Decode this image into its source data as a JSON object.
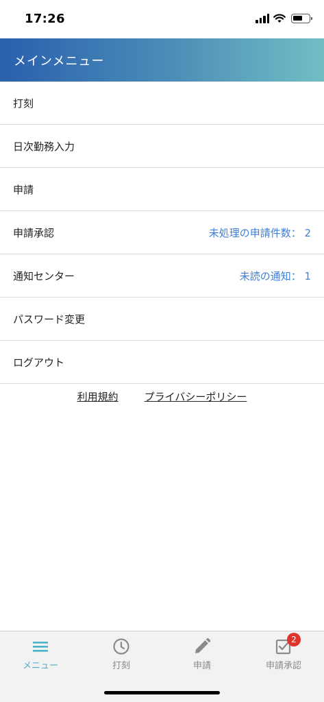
{
  "status_bar": {
    "time": "17:26"
  },
  "header": {
    "title": "メインメニュー"
  },
  "menu": {
    "items": [
      {
        "label": "打刻",
        "value": ""
      },
      {
        "label": "日次勤務入力",
        "value": ""
      },
      {
        "label": "申請",
        "value": ""
      },
      {
        "label": "申請承認",
        "value": "未処理の申請件数： 2"
      },
      {
        "label": "通知センター",
        "value": "未読の通知： 1"
      },
      {
        "label": "パスワード変更",
        "value": ""
      },
      {
        "label": "ログアウト",
        "value": ""
      }
    ]
  },
  "footer": {
    "terms": "利用規約",
    "privacy": "プライバシーポリシー"
  },
  "tabbar": {
    "tabs": [
      {
        "label": "メニュー",
        "icon": "menu-icon"
      },
      {
        "label": "打刻",
        "icon": "clock-icon"
      },
      {
        "label": "申請",
        "icon": "pencil-icon"
      },
      {
        "label": "申請承認",
        "icon": "checkbox-icon",
        "badge": "2"
      }
    ]
  },
  "colors": {
    "accent": "#48b3c9",
    "link_value": "#3f7fd6",
    "badge": "#e0332d"
  }
}
